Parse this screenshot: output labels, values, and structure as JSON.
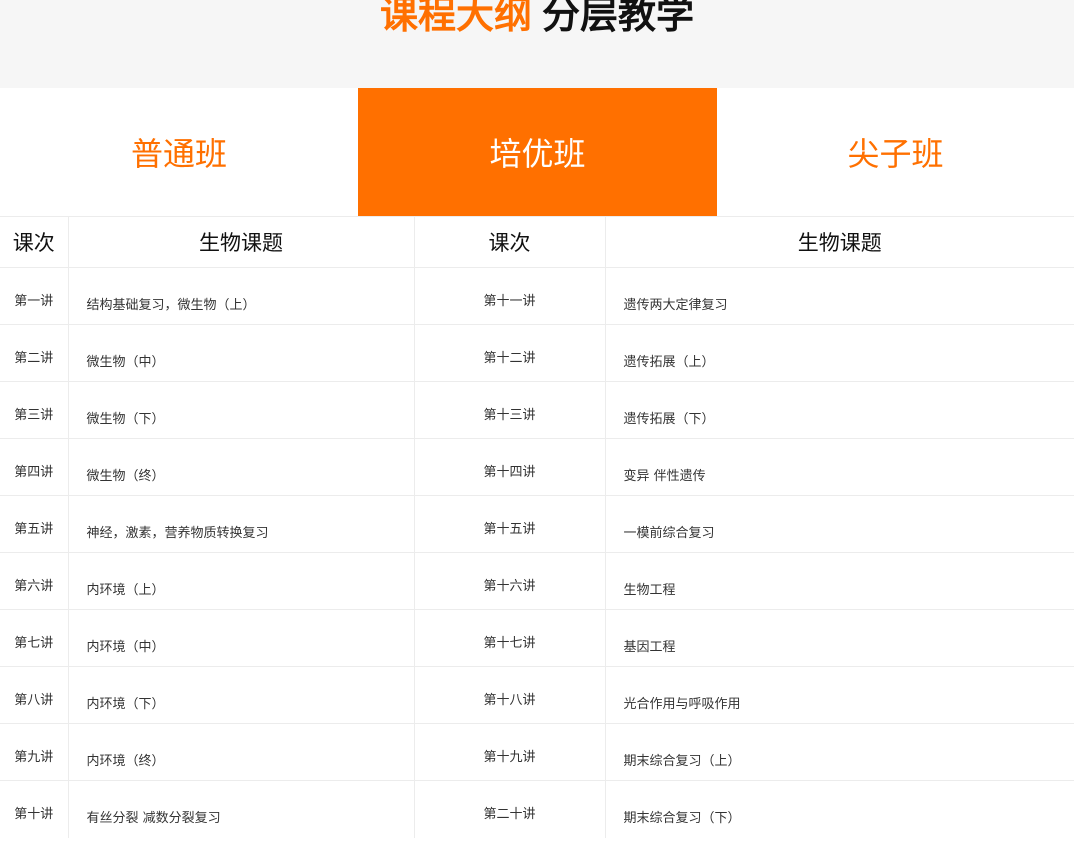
{
  "header": {
    "title_accent": "课程大纲",
    "title_main": "分层教学"
  },
  "colors": {
    "accent": "#ff7000",
    "header_bg": "#f6f6f6"
  },
  "tabs": [
    {
      "label": "普通班",
      "active": false
    },
    {
      "label": "培优班",
      "active": true
    },
    {
      "label": "尖子班",
      "active": false
    }
  ],
  "table": {
    "headers": [
      "课次",
      "生物课题",
      "课次",
      "生物课题"
    ],
    "rows": [
      {
        "lesson_a": "第一讲",
        "topic_a": "结构基础复习，微生物（上）",
        "lesson_b": "第十一讲",
        "topic_b": "遗传两大定律复习"
      },
      {
        "lesson_a": "第二讲",
        "topic_a": "微生物（中）",
        "lesson_b": "第十二讲",
        "topic_b": "遗传拓展（上）"
      },
      {
        "lesson_a": "第三讲",
        "topic_a": "微生物（下）",
        "lesson_b": "第十三讲",
        "topic_b": "遗传拓展（下）"
      },
      {
        "lesson_a": "第四讲",
        "topic_a": "微生物（终）",
        "lesson_b": "第十四讲",
        "topic_b": "变异 伴性遗传"
      },
      {
        "lesson_a": "第五讲",
        "topic_a": "神经，激素，营养物质转换复习",
        "lesson_b": "第十五讲",
        "topic_b": "一模前综合复习"
      },
      {
        "lesson_a": "第六讲",
        "topic_a": "内环境（上）",
        "lesson_b": "第十六讲",
        "topic_b": "生物工程"
      },
      {
        "lesson_a": "第七讲",
        "topic_a": "内环境（中）",
        "lesson_b": "第十七讲",
        "topic_b": "基因工程"
      },
      {
        "lesson_a": "第八讲",
        "topic_a": "内环境（下）",
        "lesson_b": "第十八讲",
        "topic_b": "光合作用与呼吸作用"
      },
      {
        "lesson_a": "第九讲",
        "topic_a": "内环境（终）",
        "lesson_b": "第十九讲",
        "topic_b": "期末综合复习（上）"
      },
      {
        "lesson_a": "第十讲",
        "topic_a": "有丝分裂 减数分裂复习",
        "lesson_b": "第二十讲",
        "topic_b": "期末综合复习（下）"
      }
    ]
  }
}
